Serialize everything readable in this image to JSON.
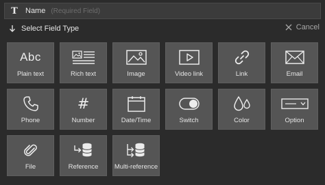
{
  "name_field": {
    "label": "Name",
    "hint": "(Required Field)",
    "icon": "text-type-icon"
  },
  "header": {
    "title": "Select Field Type",
    "cancel_label": "Cancel"
  },
  "field_types": [
    {
      "label": "Plain text",
      "icon": "abc-icon",
      "glyph": "Abc"
    },
    {
      "label": "Rich text",
      "icon": "rich-text-icon"
    },
    {
      "label": "Image",
      "icon": "image-icon"
    },
    {
      "label": "Video link",
      "icon": "video-icon"
    },
    {
      "label": "Link",
      "icon": "link-icon"
    },
    {
      "label": "Email",
      "icon": "envelope-icon"
    },
    {
      "label": "Phone",
      "icon": "phone-icon"
    },
    {
      "label": "Number",
      "icon": "hash-icon",
      "glyph": "#"
    },
    {
      "label": "Date/Time",
      "icon": "calendar-icon"
    },
    {
      "label": "Switch",
      "icon": "toggle-icon"
    },
    {
      "label": "Color",
      "icon": "droplets-icon"
    },
    {
      "label": "Option",
      "icon": "dropdown-icon"
    },
    {
      "label": "File",
      "icon": "paperclip-icon"
    },
    {
      "label": "Reference",
      "icon": "reference-icon"
    },
    {
      "label": "Multi-reference",
      "icon": "multi-reference-icon"
    }
  ],
  "colors": {
    "background": "#2b2b2b",
    "tile": "#555555",
    "text": "#e6e6e6",
    "muted": "#6e6e6e"
  }
}
